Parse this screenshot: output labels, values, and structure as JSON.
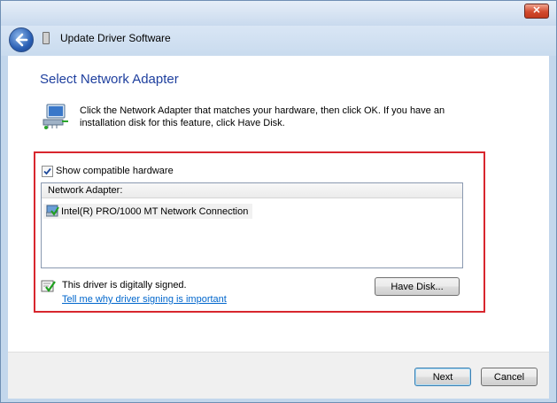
{
  "window": {
    "title": "Update Driver Software",
    "close_label": "✕"
  },
  "page": {
    "heading": "Select Network Adapter",
    "instructions": "Click the Network Adapter that matches your hardware, then click OK. If you have an installation disk for this feature, click Have Disk."
  },
  "compatible": {
    "label": "Show compatible hardware",
    "checked": true
  },
  "adapter_list": {
    "header": "Network Adapter:",
    "items": [
      {
        "label": "Intel(R) PRO/1000 MT Network Connection",
        "icon": "network-adapter-icon"
      }
    ]
  },
  "signature": {
    "status": "This driver is digitally signed.",
    "link": "Tell me why driver signing is important",
    "icon": "signed-driver-icon"
  },
  "buttons": {
    "have_disk": "Have Disk...",
    "next": "Next",
    "cancel": "Cancel"
  },
  "colors": {
    "heading": "#1e3f9e",
    "link": "#0066cc",
    "highlight_border": "#d8262e"
  }
}
